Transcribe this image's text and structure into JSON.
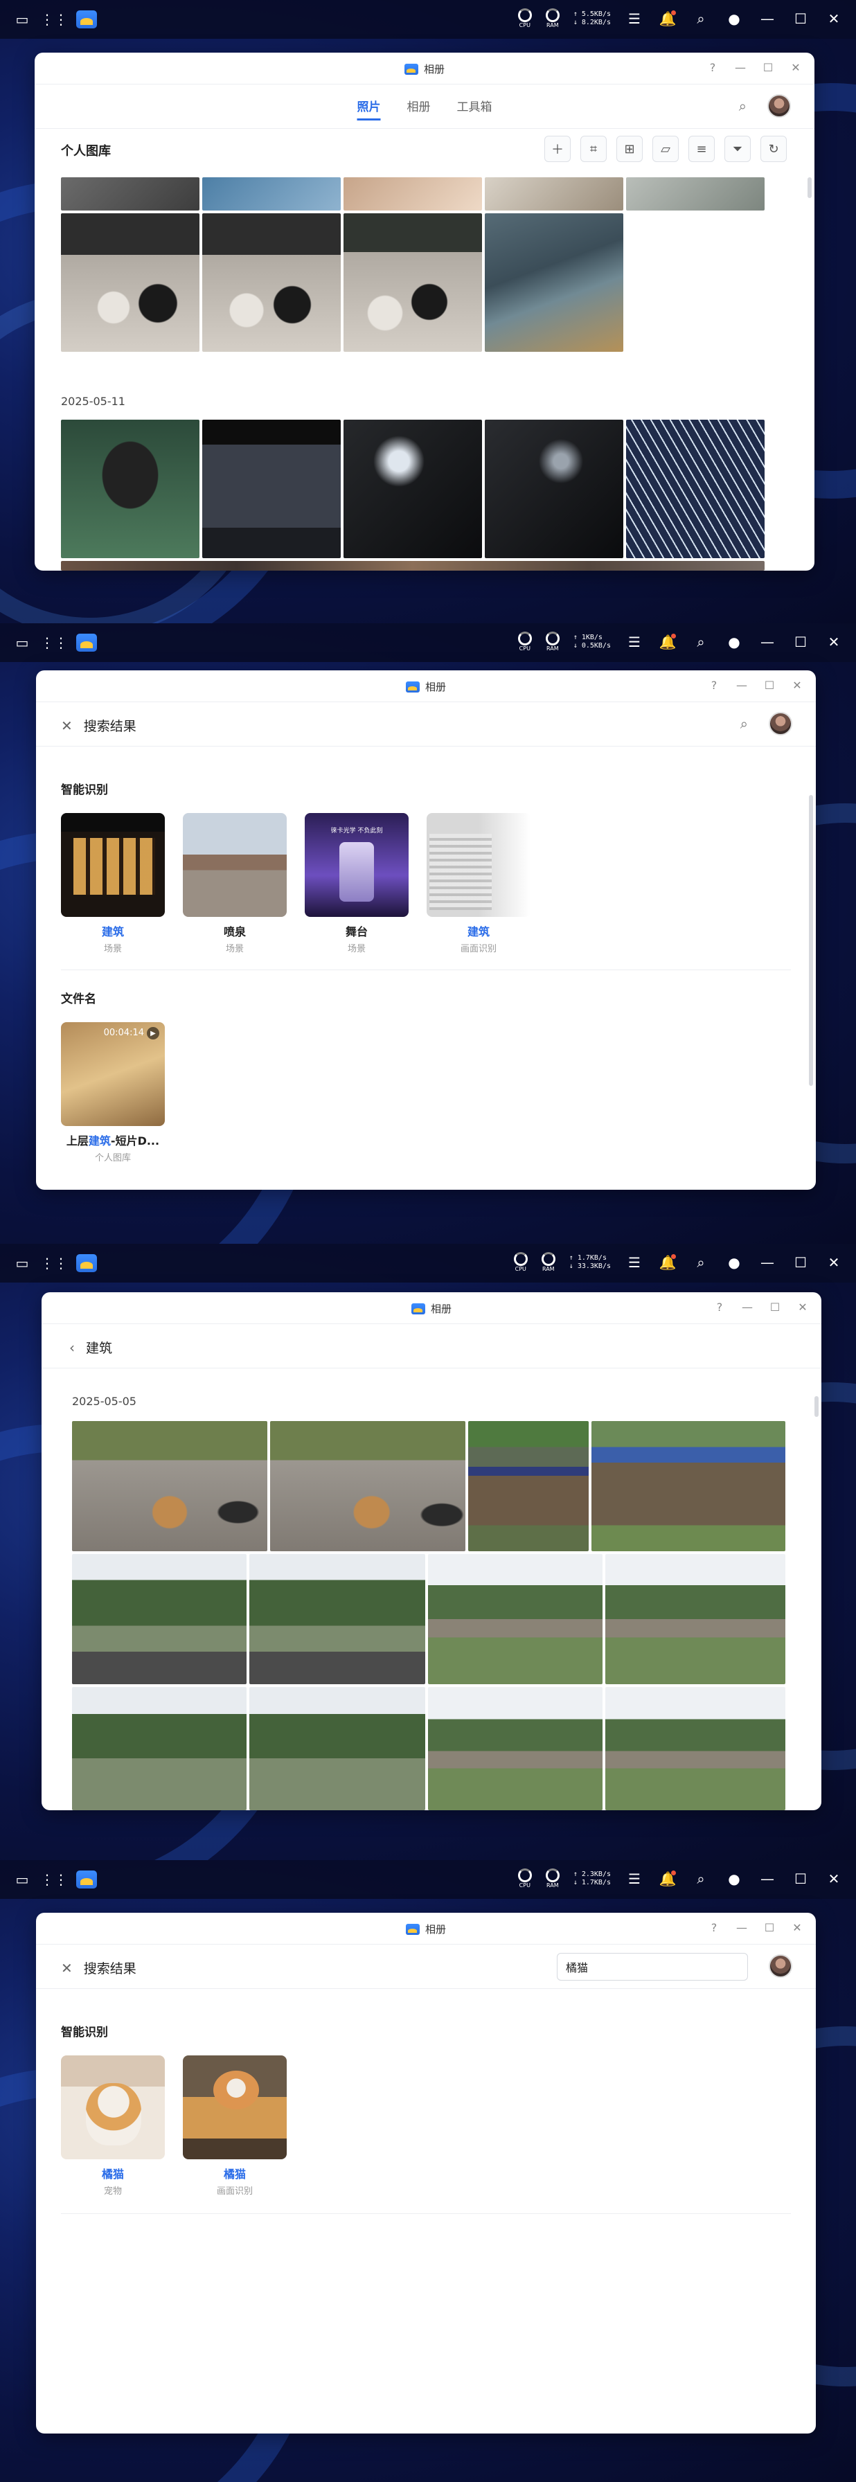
{
  "taskbar": {
    "cpu_label": "CPU",
    "ram_label": "RAM",
    "shots": [
      {
        "net_up": "↑ 5.5KB/s",
        "net_down": "↓ 8.2KB/s"
      },
      {
        "net_up": "↑ 1KB/s",
        "net_down": "↓ 0.5KB/s"
      },
      {
        "net_up": "↑ 1.7KB/s",
        "net_down": "↓ 33.3KB/s"
      },
      {
        "net_up": "↑ 2.3KB/s",
        "net_down": "↓ 1.7KB/s"
      }
    ],
    "icons": [
      "show-desktop-icon",
      "app-grid-icon",
      "photos-app-icon",
      "cpu-meter-icon",
      "ram-meter-icon",
      "monitor-icon",
      "bell-icon",
      "search-icon",
      "user-icon",
      "minimize-icon",
      "maximize-icon",
      "close-icon"
    ]
  },
  "window": {
    "title": "相册",
    "help": "?",
    "minimize": "—",
    "maximize": "☐",
    "close": "✕"
  },
  "screen1": {
    "tabs": [
      "照片",
      "相册",
      "工具箱"
    ],
    "active_tab": "照片",
    "section_title": "个人图库",
    "toolbar_icons": [
      "add-icon",
      "face-scan-icon",
      "grid-view-icon",
      "folder-icon",
      "sort-list-icon",
      "filter-icon",
      "refresh-icon"
    ],
    "date_group": "2025-05-11"
  },
  "screen2": {
    "header": "搜索结果",
    "smart_section": "智能识别",
    "smart_items": [
      {
        "label": "建筑",
        "highlight": true,
        "sub": "场景"
      },
      {
        "label": "喷泉",
        "highlight": false,
        "sub": "场景"
      },
      {
        "label": "舞台",
        "highlight": false,
        "sub": "场景"
      },
      {
        "label": "建筑",
        "highlight": true,
        "sub": "画面识别"
      }
    ],
    "file_section": "文件名",
    "file_item": {
      "prefix": "上层",
      "match": "建筑",
      "suffix": "-短片D...",
      "sub": "个人图库",
      "duration": "00:04:14"
    },
    "stage_caption": "徕卡光学 不负此刻"
  },
  "screen3": {
    "header": "建筑",
    "date_group": "2025-05-05"
  },
  "screen4": {
    "header": "搜索结果",
    "search_value": "橘猫",
    "smart_section": "智能识别",
    "smart_items": [
      {
        "label": "橘猫",
        "sub": "宠物"
      },
      {
        "label": "橘猫",
        "sub": "画面识别"
      }
    ]
  },
  "colors": {
    "accent": "#2a6ce8",
    "taskbar": "#080c28",
    "window_bg": "#ffffff"
  }
}
